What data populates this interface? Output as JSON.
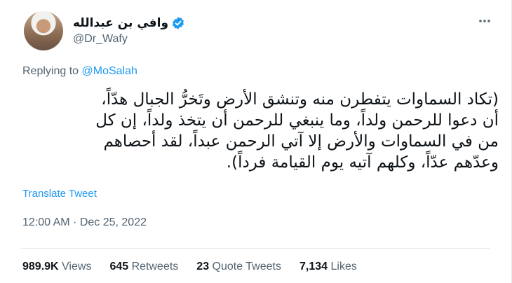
{
  "author": {
    "display_name": "وافي بن عبدالله",
    "handle": "@Dr_Wafy",
    "verified_icon": "verified-badge-icon"
  },
  "reply": {
    "prefix": "Replying to ",
    "mention": "@MoSalah"
  },
  "tweet": {
    "lines": [
      "(تكاد السماوات يتفطرن منه وتنشق الأرض وتَخرُّ الجبال هدّاً،",
      "أن دعوا للرحمن ولداً، وما ينبغي للرحمن أن يتخذ ولداً، إن كل",
      "من في السماوات والأرض إلا آتي الرحمن عبداً، لقد أحصاهم",
      "وعدّهم عدّاً، وكلهم آتيه يوم القيامة فرداً)."
    ]
  },
  "translate_label": "Translate Tweet",
  "timestamp": "12:00 AM · Dec 25, 2022",
  "stats": {
    "views_count": "989.9K",
    "views_label": "Views",
    "retweets_count": "645",
    "retweets_label": "Retweets",
    "quotes_count": "23",
    "quotes_label": "Quote Tweets",
    "likes_count": "7,134",
    "likes_label": "Likes"
  },
  "colors": {
    "accent": "#1d9bf0",
    "secondary_text": "#536471",
    "primary_text": "#0f1419"
  }
}
